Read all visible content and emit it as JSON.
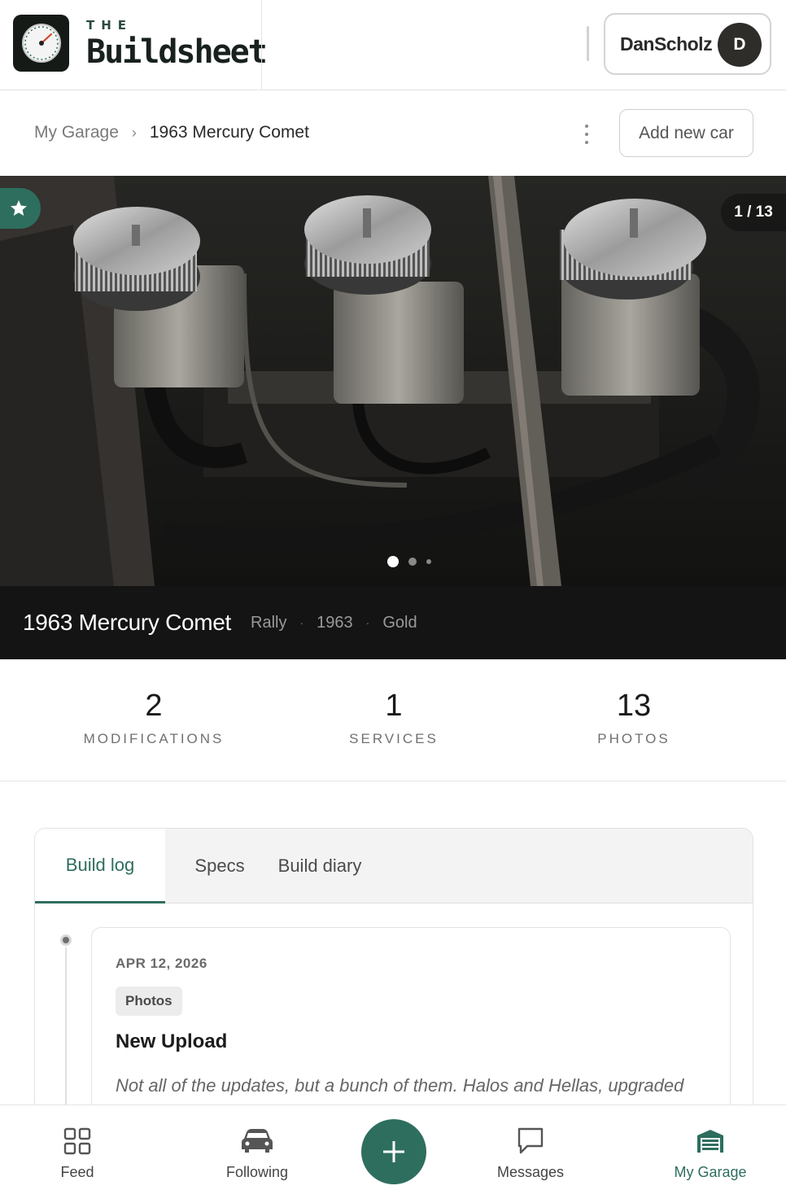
{
  "app": {
    "brand_prefix": "THE",
    "brand_name": "Buildsheet",
    "accent_color": "#2e6e5e"
  },
  "user": {
    "name": "DanScholz",
    "initial": "D"
  },
  "breadcrumb": {
    "parent": "My Garage",
    "separator": "›",
    "current": "1963 Mercury Comet"
  },
  "actions": {
    "add_car_label": "Add new car",
    "more_icon": "kebab-menu-icon"
  },
  "gallery": {
    "counter": "1 / 13",
    "favorite_icon": "star-icon",
    "image_description_icon": "engine-photo"
  },
  "car": {
    "title": "1963 Mercury Comet",
    "trim": "Rally",
    "year": "1963",
    "color": "Gold",
    "separator": "·"
  },
  "stats": [
    {
      "value": "2",
      "label": "MODIFICATIONS"
    },
    {
      "value": "1",
      "label": "SERVICES"
    },
    {
      "value": "13",
      "label": "PHOTOS"
    }
  ],
  "tabs": [
    {
      "label": "Build log",
      "active": true
    },
    {
      "label": "Specs",
      "active": false
    },
    {
      "label": "Build diary",
      "active": false
    }
  ],
  "log_entry": {
    "date": "APR 12, 2026",
    "tag": "Photos",
    "title": "New Upload",
    "text": "Not all of the updates, but a bunch of them. Halos and Hellas, upgraded lighting and some other odds and ends I did over the winter."
  },
  "bottom_nav": [
    {
      "label": "Feed",
      "icon": "grid-icon",
      "active": false
    },
    {
      "label": "Following",
      "icon": "car-icon",
      "active": false
    },
    {
      "label": "Messages",
      "icon": "chat-bubble-icon",
      "active": false
    },
    {
      "label": "My Garage",
      "icon": "garage-icon",
      "active": true
    }
  ],
  "fab": {
    "icon": "plus-icon"
  }
}
